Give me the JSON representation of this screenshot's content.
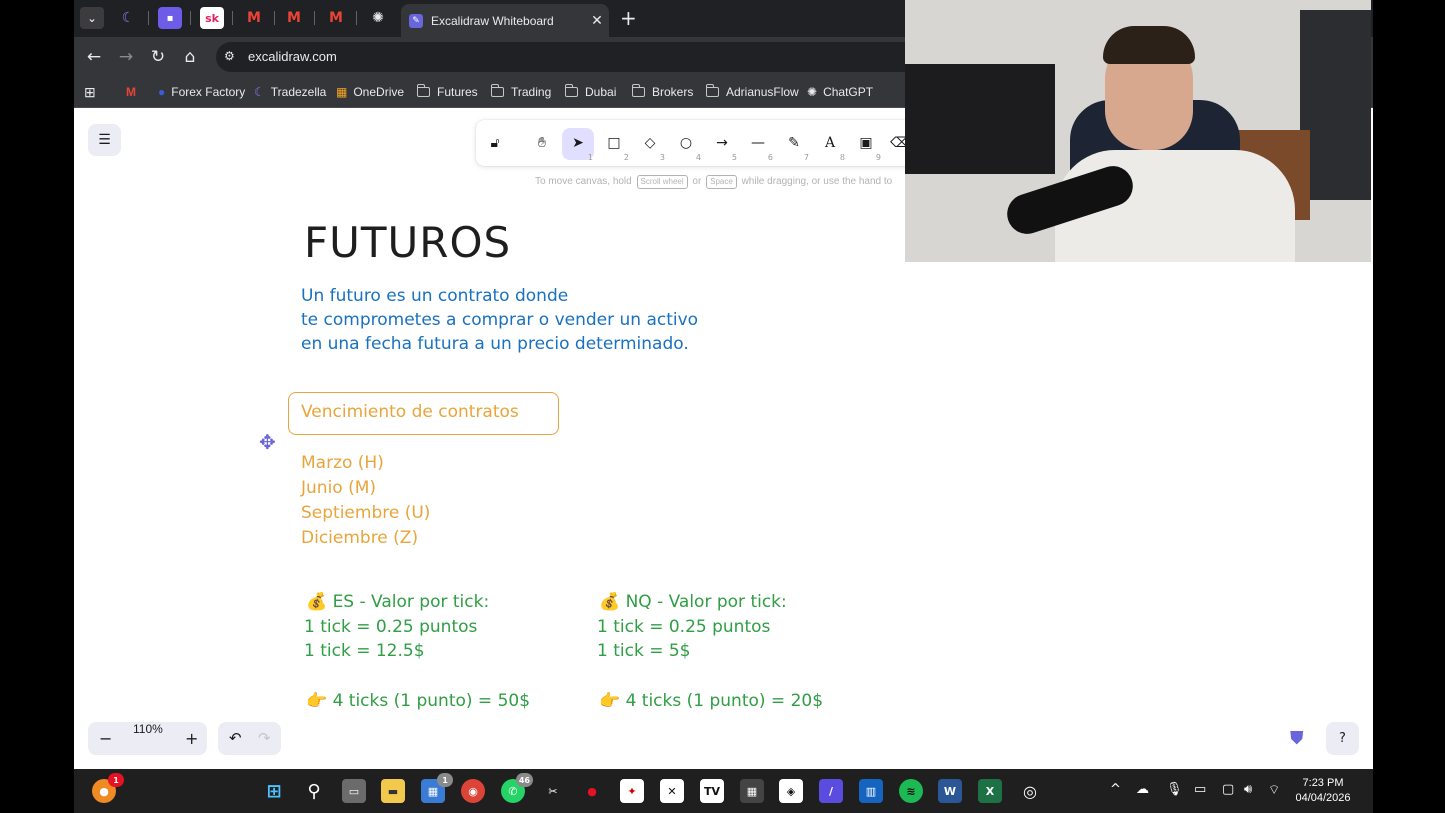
{
  "browser": {
    "active_tab_title": "Excalidraw Whiteboard",
    "url": "excalidraw.com",
    "bookmarks": [
      "Forex Factory",
      "Tradezella",
      "OneDrive",
      "Futures",
      "Trading",
      "Dubai",
      "Brokers",
      "AdrianusFlow",
      "ChatGPT"
    ],
    "mini_tabs": [
      "sk"
    ]
  },
  "excalidraw": {
    "hint_start": "To move canvas, hold",
    "hint_key1": "Scroll wheel",
    "hint_or": "or",
    "hint_key2": "Space",
    "hint_end": "while dragging, or use the hand to",
    "tool_keys": [
      "1",
      "2",
      "3",
      "4",
      "5",
      "6",
      "7",
      "8",
      "9"
    ],
    "zoom": "110%",
    "accent": "#6965db"
  },
  "drawing": {
    "title": "FUTUROS",
    "definition": [
      "Un futuro es un contrato donde",
      "te comprometes a comprar o vender un activo",
      "en una fecha futura a un precio determinado."
    ],
    "box_label": "Vencimiento de contratos",
    "months": [
      "Marzo (H)",
      "Junio (M)",
      "Septiembre (U)",
      "Diciembre (Z)"
    ],
    "es": {
      "header": "💰 ES - Valor por tick:",
      "line1": "1 tick = 0.25 puntos",
      "line2": "1 tick = 12.5$",
      "summary": "👉 4 ticks (1 punto) = 50$"
    },
    "nq": {
      "header": "💰 NQ - Valor por tick:",
      "line1": "1 tick = 0.25 puntos",
      "line2": "1 tick = 5$",
      "summary": "👉 4 ticks (1 punto) = 20$"
    },
    "colors": {
      "title": "#1e1e1e",
      "blue": "#1971c2",
      "orange": "#e8a53b",
      "green": "#2f9e44"
    }
  },
  "taskbar": {
    "time": "7:23 PM",
    "date": "04/04/2026",
    "badges": {
      "firefox": "1",
      "store": "1",
      "whatsapp": "46"
    }
  }
}
